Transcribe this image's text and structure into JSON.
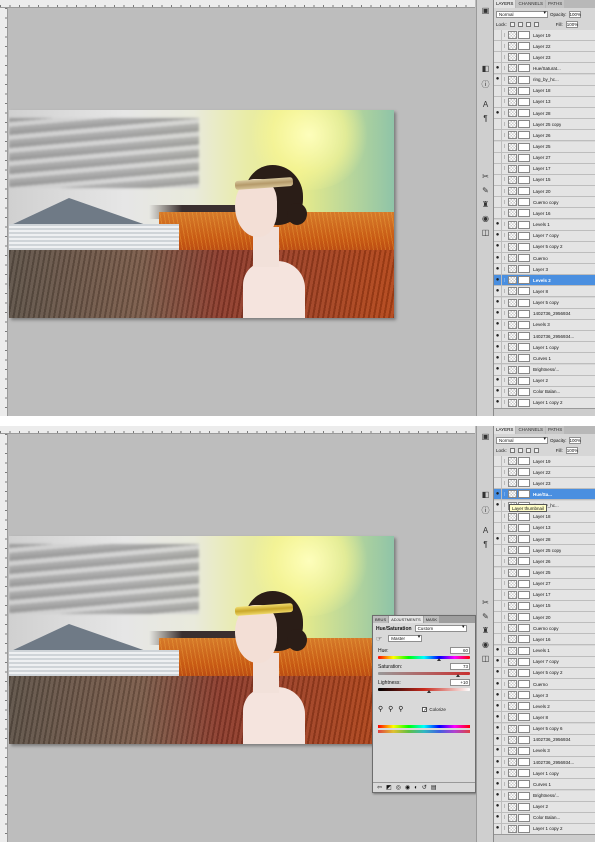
{
  "tabs": [
    "LAYERS",
    "CHANNELS",
    "PATHS"
  ],
  "blend_mode": "Normal",
  "opacity_label": "Opacity:",
  "opacity_value": "100%",
  "lock_label": "Lock:",
  "fill_label": "Fill:",
  "fill_value": "100%",
  "top_layers": [
    "Layer 19",
    "Layer 22",
    "Layer 23",
    "Hue/Saturat...",
    "ring_by_hc...",
    "Layer 18",
    "Layer 13",
    "Layer 28",
    "Layer 25 copy",
    "Layer 26",
    "Layer 25",
    "Layer 27",
    "Layer 17",
    "Layer 15",
    "Layer 20",
    "Cuerno copy",
    "Layer 16",
    "Levels 1",
    "Layer 7 copy",
    "Layer 5 copy 2",
    "Cuerno",
    "Layer 3",
    "Levels 2",
    "Layer 8",
    "Layer 5 copy",
    "1402736_2956934",
    "Levels 3",
    "1402736_2956934...",
    "Layer 1 copy",
    "Curves 1",
    "Brightness/...",
    "Layer 2",
    "Color Balan...",
    "Layer 1 copy 2"
  ],
  "bottom_layers": [
    "Layer 19",
    "Layer 22",
    "Layer 23",
    "Hue/Sa...",
    "ring_by_hc...",
    "Layer 18",
    "Layer 13",
    "Layer 28",
    "Layer 25 copy",
    "Layer 26",
    "Layer 25",
    "Layer 27",
    "Layer 17",
    "Layer 15",
    "Layer 20",
    "Cuerno copy",
    "Layer 16",
    "Levels 1",
    "Layer 7 copy",
    "Layer 5 copy 2",
    "Cuerno",
    "Layer 3",
    "Levels 2",
    "Layer 8",
    "Layer 5 copy 6",
    "1402736_2956934",
    "Levels 3",
    "1402736_2956934...",
    "Layer 1 copy",
    "Curves 1",
    "Brightness/...",
    "Layer 2",
    "Color Balan...",
    "Layer 1 copy 2"
  ],
  "tooltip": "Layer thumbnail",
  "adjustments": {
    "tabs": [
      "BRUS",
      "ADJUSTMENTS",
      "MASK"
    ],
    "title": "Hue/Saturation",
    "preset": "Custom",
    "channel": "Master",
    "hue_label": "Hue:",
    "hue_value": "60",
    "saturation_label": "Saturation:",
    "saturation_value": "73",
    "lightness_label": "Lightness:",
    "lightness_value": "+10",
    "colorize_label": "Colorize",
    "colorize_checked": true
  },
  "colors": {
    "selection": "#4a8fe0",
    "panel_bg": "#d6d6d6",
    "canvas_bg": "#bdbdbd"
  }
}
